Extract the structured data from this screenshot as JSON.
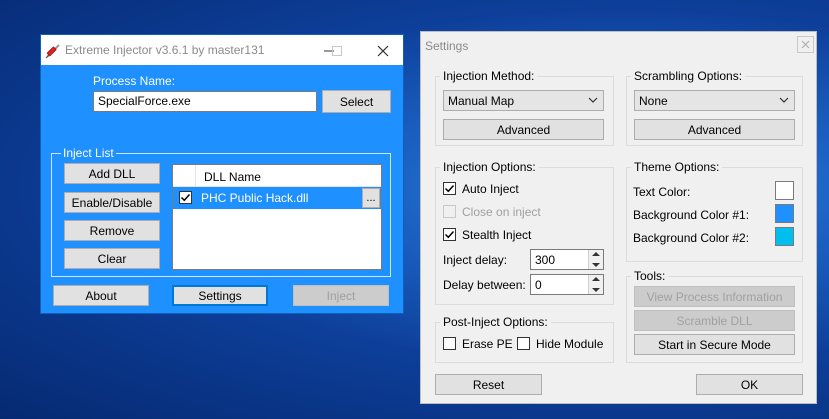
{
  "injector": {
    "title": "Extreme Injector v3.6.1 by master131",
    "process_label": "Process Name:",
    "process_value": "SpecialForce.exe",
    "select_label": "Select",
    "inject_list_label": "Inject List",
    "add_dll": "Add DLL",
    "enable_disable": "Enable/Disable",
    "remove": "Remove",
    "clear": "Clear",
    "dll_header": "DLL Name",
    "dll_items": [
      {
        "name": "PHC Public Hack.dll",
        "checked": true,
        "more": "..."
      }
    ],
    "about": "About",
    "settings": "Settings",
    "inject": "Inject"
  },
  "settings": {
    "title": "Settings",
    "injection_method": {
      "label": "Injection Method:",
      "value": "Manual Map",
      "advanced": "Advanced"
    },
    "scrambling": {
      "label": "Scrambling Options:",
      "value": "None",
      "advanced": "Advanced"
    },
    "injection_options": {
      "label": "Injection Options:",
      "auto_inject": "Auto Inject",
      "close_on_inject": "Close on inject",
      "stealth_inject": "Stealth Inject",
      "inject_delay_label": "Inject delay:",
      "inject_delay_value": "300",
      "delay_between_label": "Delay between:",
      "delay_between_value": "0"
    },
    "theme": {
      "label": "Theme Options:",
      "text_color": "Text Color:",
      "bg1": "Background Color #1:",
      "bg2": "Background Color #2:",
      "text_color_hex": "#ffffff",
      "bg1_hex": "#1e90ff",
      "bg2_hex": "#00bfef"
    },
    "post_inject": {
      "label": "Post-Inject Options:",
      "erase_pe": "Erase PE",
      "hide_module": "Hide Module"
    },
    "tools": {
      "label": "Tools:",
      "view_process": "View Process Information",
      "scramble_dll": "Scramble DLL",
      "secure_mode": "Start in Secure Mode"
    },
    "reset": "Reset",
    "ok": "OK"
  }
}
